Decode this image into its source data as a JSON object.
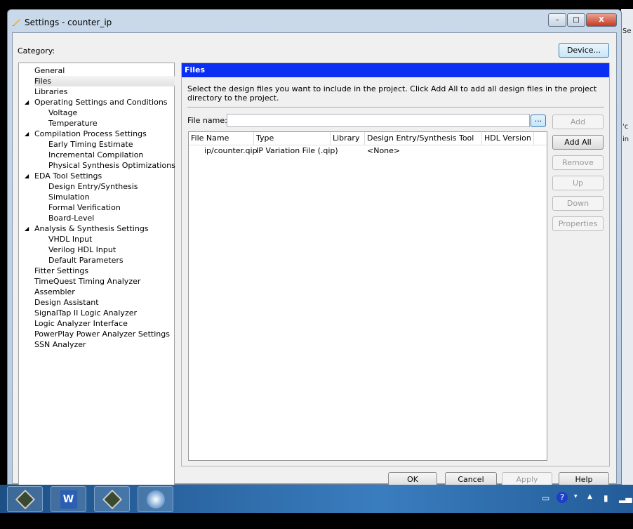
{
  "window": {
    "title": "Settings - counter_ip",
    "minimize": "–",
    "maximize": "□",
    "close": "X"
  },
  "category_label": "Category:",
  "device_button": "Device...",
  "tree": [
    {
      "label": "General",
      "level": 0
    },
    {
      "label": "Files",
      "level": 0,
      "selected": true
    },
    {
      "label": "Libraries",
      "level": 0
    },
    {
      "label": "Operating Settings and Conditions",
      "level": 0,
      "expanded": true
    },
    {
      "label": "Voltage",
      "level": 1
    },
    {
      "label": "Temperature",
      "level": 1
    },
    {
      "label": "Compilation Process Settings",
      "level": 0,
      "expanded": true
    },
    {
      "label": "Early Timing Estimate",
      "level": 1
    },
    {
      "label": "Incremental Compilation",
      "level": 1
    },
    {
      "label": "Physical Synthesis Optimizations",
      "level": 1
    },
    {
      "label": "EDA Tool Settings",
      "level": 0,
      "expanded": true
    },
    {
      "label": "Design Entry/Synthesis",
      "level": 1
    },
    {
      "label": "Simulation",
      "level": 1
    },
    {
      "label": "Formal Verification",
      "level": 1
    },
    {
      "label": "Board-Level",
      "level": 1
    },
    {
      "label": "Analysis & Synthesis Settings",
      "level": 0,
      "expanded": true
    },
    {
      "label": "VHDL Input",
      "level": 1
    },
    {
      "label": "Verilog HDL Input",
      "level": 1
    },
    {
      "label": "Default Parameters",
      "level": 1
    },
    {
      "label": "Fitter Settings",
      "level": 0
    },
    {
      "label": "TimeQuest Timing Analyzer",
      "level": 0
    },
    {
      "label": "Assembler",
      "level": 0
    },
    {
      "label": "Design Assistant",
      "level": 0
    },
    {
      "label": "SignalTap II Logic Analyzer",
      "level": 0
    },
    {
      "label": "Logic Analyzer Interface",
      "level": 0
    },
    {
      "label": "PowerPlay Power Analyzer Settings",
      "level": 0
    },
    {
      "label": "SSN Analyzer",
      "level": 0
    }
  ],
  "panel": {
    "title": "Files",
    "description": "Select the design files you want to include in the project. Click Add All to add all design files in the project directory to the project.",
    "file_name_label": "File name:",
    "file_name_value": "",
    "browse_label": "...",
    "columns": [
      "File Name",
      "Type",
      "Library",
      "Design Entry/Synthesis Tool",
      "HDL Version"
    ],
    "rows": [
      [
        "ip/counter.qip",
        "IP Variation File (.qip)",
        "",
        "<None>",
        ""
      ]
    ],
    "side_buttons": [
      {
        "label": "Add",
        "enabled": false
      },
      {
        "label": "Add All",
        "enabled": true
      },
      {
        "label": "Remove",
        "enabled": false
      },
      {
        "label": "Up",
        "enabled": false
      },
      {
        "label": "Down",
        "enabled": false
      },
      {
        "label": "Properties",
        "enabled": false
      }
    ]
  },
  "footer": [
    {
      "label": "OK",
      "enabled": true
    },
    {
      "label": "Cancel",
      "enabled": true
    },
    {
      "label": "Apply",
      "enabled": false
    },
    {
      "label": "Help",
      "enabled": true
    }
  ],
  "taskbar": {
    "apps": [
      "quartus-icon",
      "word-icon",
      "quartus-programmer-icon",
      "signaltap-icon"
    ],
    "word_letter": "W"
  },
  "background_text": [
    "Se",
    "'c",
    "in"
  ]
}
